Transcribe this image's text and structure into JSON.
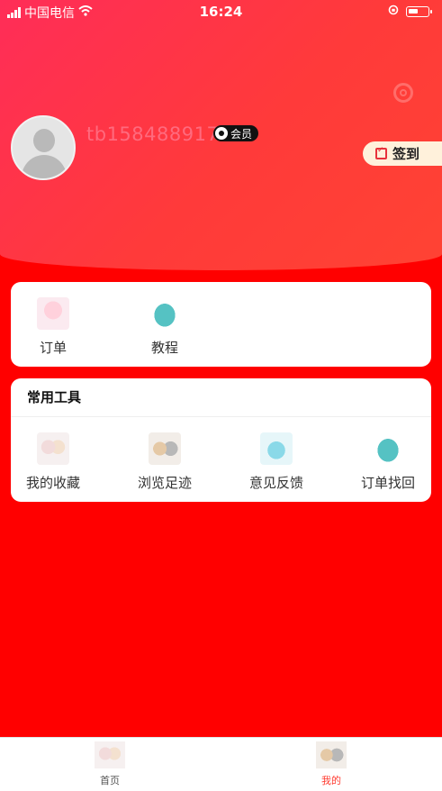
{
  "status_bar": {
    "carrier": "中国电信",
    "time": "16:24"
  },
  "profile": {
    "username": "tb1584889171",
    "vip_label": "会员"
  },
  "signin": {
    "label": "签到"
  },
  "orders_card": {
    "items": [
      {
        "label": "订单",
        "icon": "plush-deer-icon"
      },
      {
        "label": "教程",
        "icon": "plush-dino-icon"
      }
    ]
  },
  "tools": {
    "title": "常用工具",
    "items": [
      {
        "label": "我的收藏",
        "icon": "plush-bunny-icon"
      },
      {
        "label": "浏览足迹",
        "icon": "plush-bear-icon"
      },
      {
        "label": "意见反馈",
        "icon": "plush-pig-icon"
      },
      {
        "label": "订单找回",
        "icon": "plush-dino-icon"
      }
    ]
  },
  "tabbar": {
    "items": [
      {
        "label": "首页",
        "active": false
      },
      {
        "label": "我的",
        "active": true
      }
    ]
  },
  "colors": {
    "accent": "#ff3b30",
    "background": "#ff0000",
    "signin_bg": "#fff1db"
  }
}
